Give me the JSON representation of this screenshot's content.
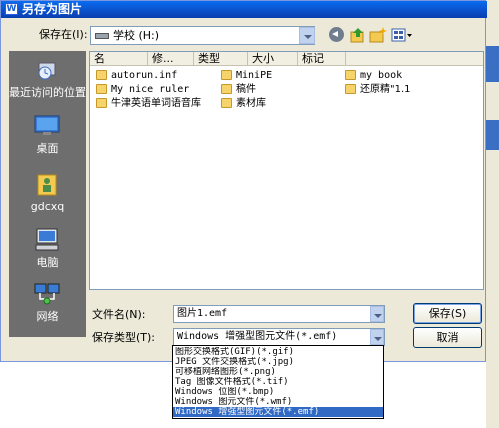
{
  "window": {
    "title": "另存为图片",
    "icon_glyph": "W"
  },
  "toolbar": {
    "save_in_label": "保存在(I):",
    "location": "学校 (H:)",
    "icons": [
      "back-icon",
      "up-folder-icon",
      "new-folder-icon",
      "views-menu-icon"
    ]
  },
  "places": [
    {
      "id": "recent",
      "label": "最近访问的位置",
      "icon": "recent-places-icon"
    },
    {
      "id": "desktop",
      "label": "桌面",
      "icon": "desktop-icon"
    },
    {
      "id": "user",
      "label": "gdcxq",
      "icon": "user-folder-icon"
    },
    {
      "id": "computer",
      "label": "电脑",
      "icon": "computer-icon"
    },
    {
      "id": "network",
      "label": "网络",
      "icon": "network-icon"
    }
  ],
  "list": {
    "columns": [
      "名称",
      "修改日期",
      "类型",
      "大小",
      "标记"
    ],
    "columns_display": [
      "名",
      "修...",
      "类型",
      "大小",
      "标记"
    ],
    "files": [
      {
        "name": "autorun.inf",
        "type": "folder"
      },
      {
        "name": "My nice ruler",
        "type": "folder"
      },
      {
        "name": "牛津英语单词语音库",
        "type": "folder"
      },
      {
        "name": "MiniPE",
        "type": "folder"
      },
      {
        "name": "稿件",
        "type": "folder"
      },
      {
        "name": "素材库",
        "type": "folder"
      },
      {
        "name": "my book",
        "type": "folder"
      },
      {
        "name": "还原精\"1.1",
        "type": "folder"
      }
    ]
  },
  "form": {
    "filename_label": "文件名(N):",
    "filename_value": "图片1.emf",
    "filetype_label": "保存类型(T):",
    "filetype_value": "Windows 增强型图元文件(*.emf)",
    "save_button": "保存(S)",
    "cancel_button": "取消"
  },
  "type_options": [
    "图形交换格式(GIF)(*.gif)",
    "JPEG 文件交换格式(*.jpg)",
    "可移植网络图形(*.png)",
    "Tag 图像文件格式(*.tif)",
    "Windows 位图(*.bmp)",
    "Windows 图元文件(*.wmf)",
    "Windows 增强型图元文件(*.emf)"
  ],
  "selected_type_index": 6,
  "colors": {
    "title_bar": "#0b4fc9",
    "dialog_bg": "#ece9d8",
    "places_bg": "#6e6e6e",
    "selection": "#316ac5"
  }
}
